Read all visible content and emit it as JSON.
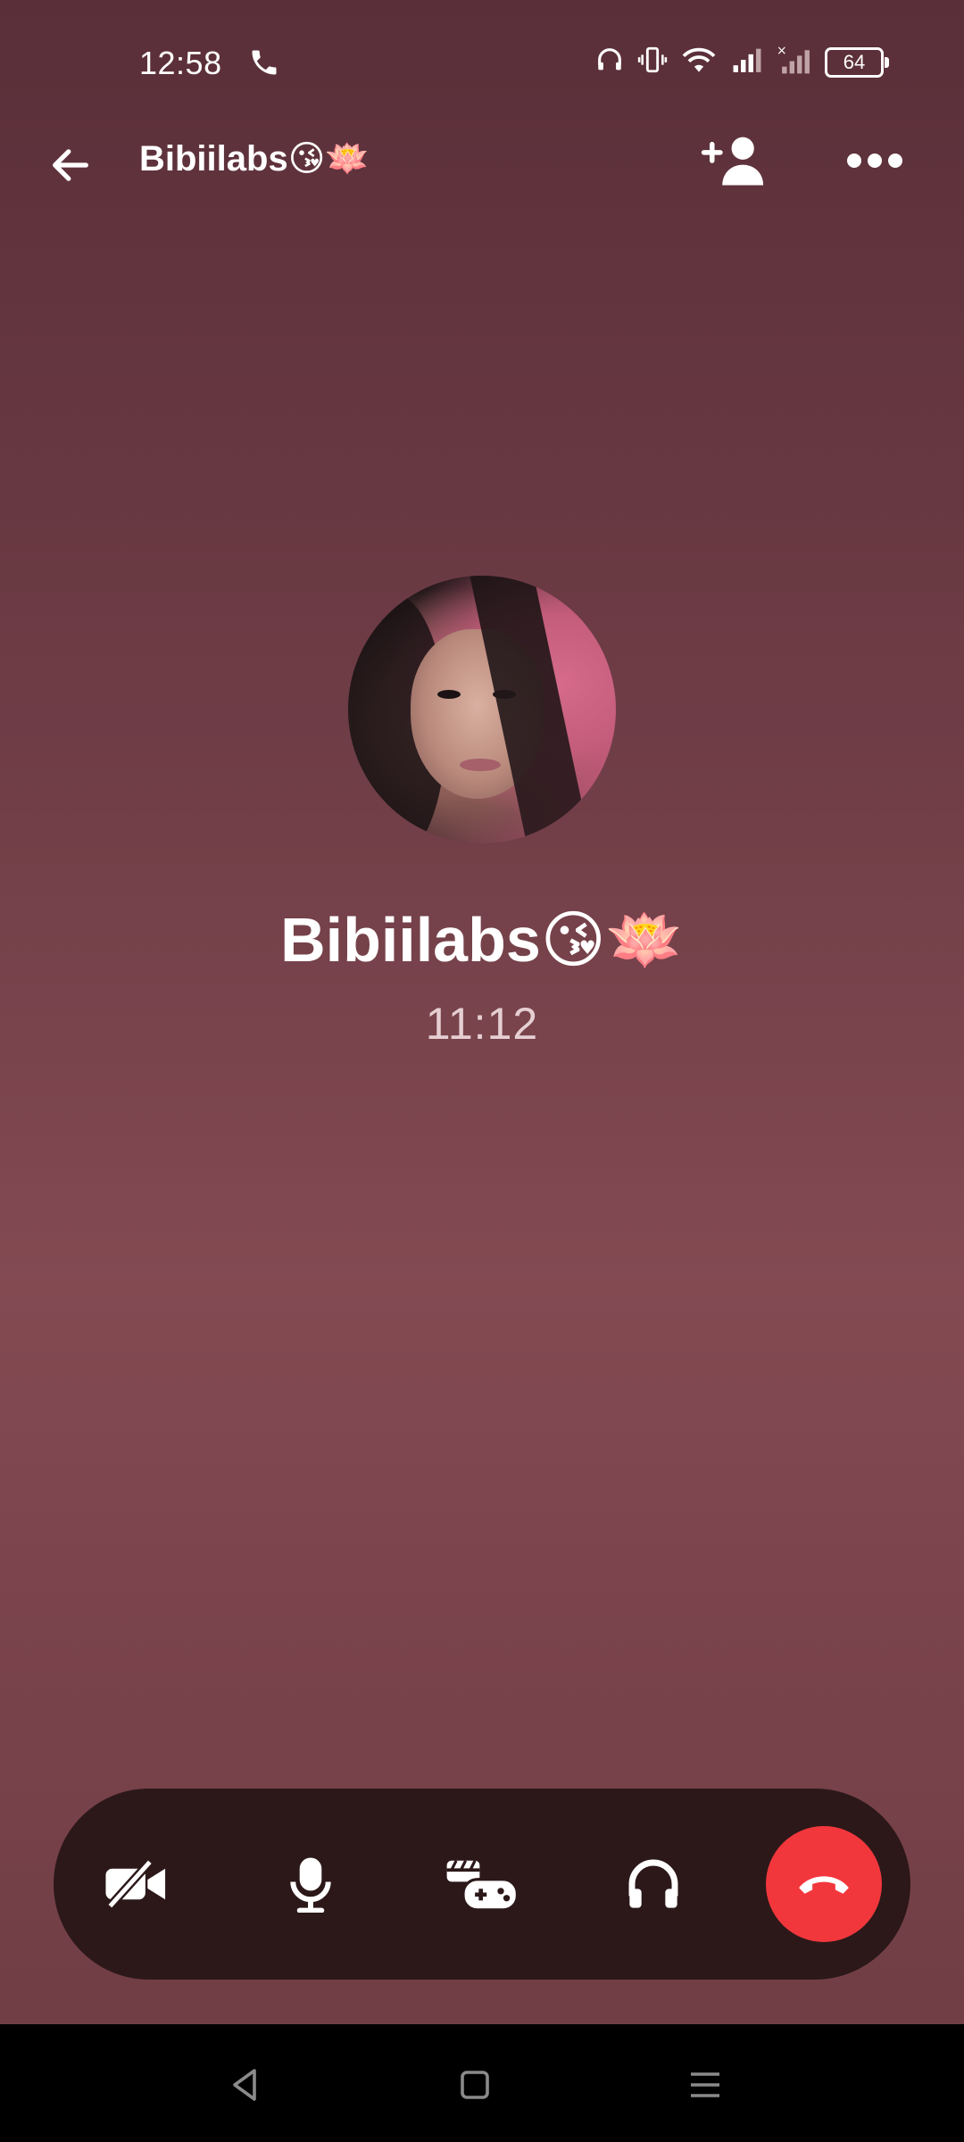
{
  "status_bar": {
    "time": "12:58",
    "battery": "64",
    "icons": [
      "phone-call-icon",
      "headphones-icon",
      "vibrate-icon",
      "wifi-icon",
      "signal-icon",
      "signal-no-service-icon",
      "battery-icon"
    ]
  },
  "header": {
    "title": "Bibiilabs😘🪷"
  },
  "caller": {
    "name": "Bibiilabs😘🪷",
    "duration": "11:12"
  },
  "controls": [
    {
      "name": "video-off",
      "icon": "video-off-icon"
    },
    {
      "name": "microphone",
      "icon": "microphone-icon"
    },
    {
      "name": "games",
      "icon": "games-icon"
    },
    {
      "name": "audio",
      "icon": "headphones-icon"
    },
    {
      "name": "end-call",
      "icon": "phone-hangup-icon",
      "color": "#f2373c"
    }
  ],
  "nav": [
    "back",
    "home",
    "recents"
  ],
  "colors": {
    "background_top": "#5a2f39",
    "background_mid": "#834a52",
    "control_bar": "#2c1819",
    "end_call": "#f2373c"
  }
}
